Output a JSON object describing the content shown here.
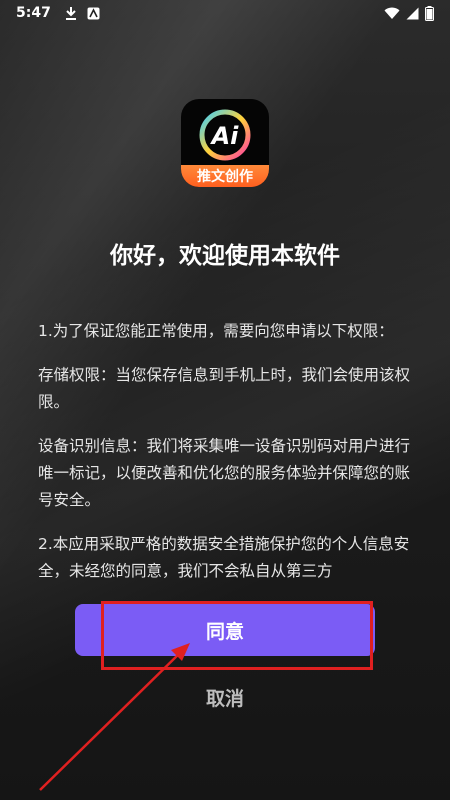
{
  "status_bar": {
    "time": "5:47"
  },
  "logo": {
    "banner_text": "推文创作",
    "mark_text": "Ai"
  },
  "dialog": {
    "title": "你好，欢迎使用本软件",
    "paragraphs": [
      "1.为了保证您能正常使用，需要向您申请以下权限：",
      "存储权限：当您保存信息到手机上时，我们会使用该权限。",
      "设备识别信息：我们将采集唯一设备识别码对用户进行唯一标记，以便改善和优化您的服务体验并保障您的账号安全。",
      "2.本应用采取严格的数据安全措施保护您的个人信息安全，未经您的同意，我们不会私自从第三方"
    ],
    "agree_label": "同意",
    "cancel_label": "取消"
  },
  "colors": {
    "accent": "#7b5cf5",
    "highlight": "#e02020"
  }
}
